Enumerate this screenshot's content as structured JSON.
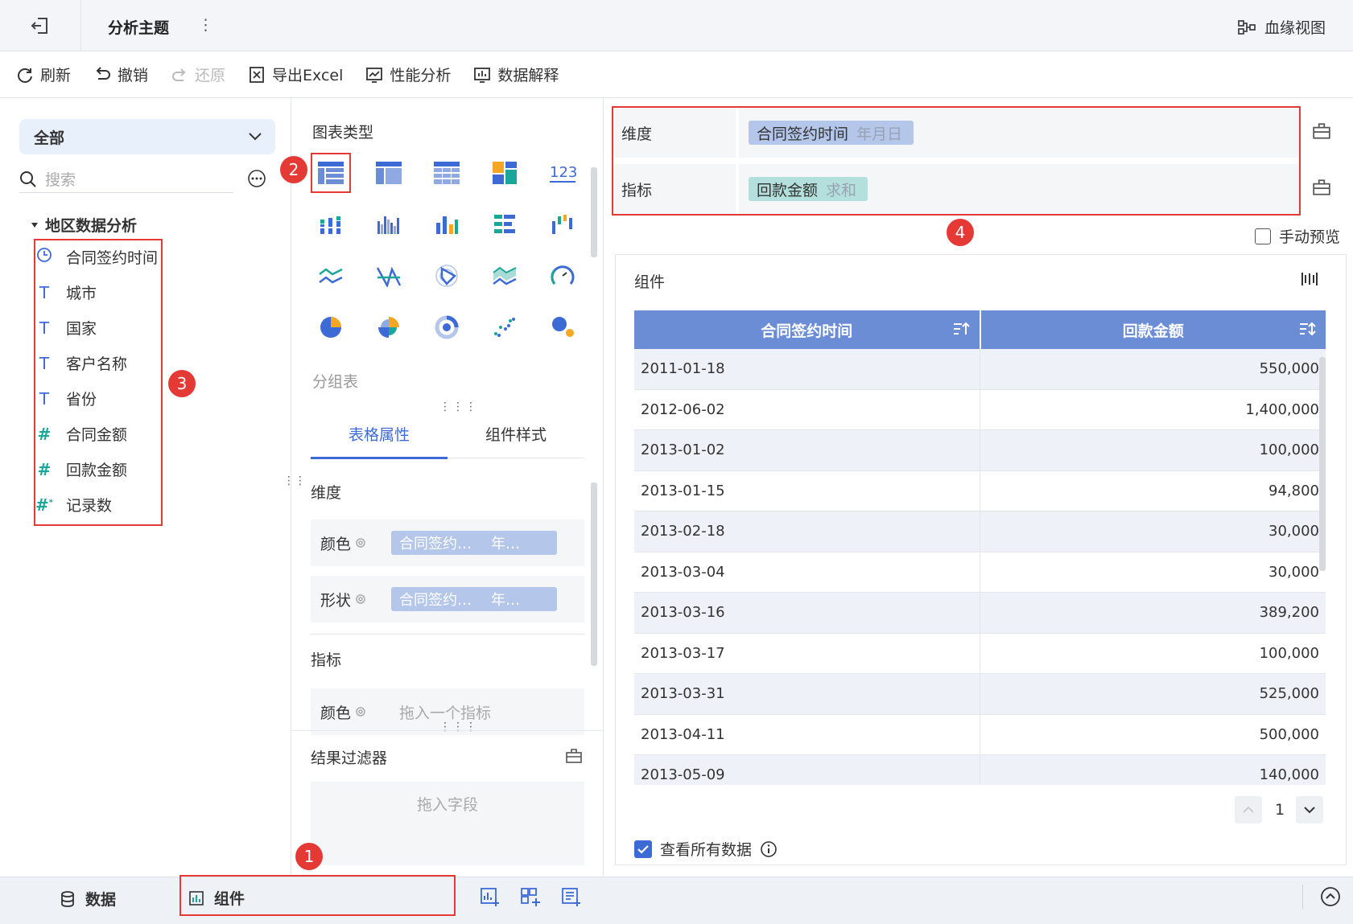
{
  "titlebar": {
    "title": "分析主题",
    "more": "⋮",
    "lineage_label": "血缘视图"
  },
  "toolbar": {
    "refresh": "刷新",
    "undo": "撤销",
    "redo": "还原",
    "export": "导出Excel",
    "perf": "性能分析",
    "explain": "数据解释"
  },
  "left": {
    "scope": "全部",
    "search_placeholder": "搜索",
    "group_title": "地区数据分析",
    "fields": [
      {
        "type": "time",
        "label": "合同签约时间"
      },
      {
        "type": "text",
        "label": "城市"
      },
      {
        "type": "text",
        "label": "国家"
      },
      {
        "type": "text",
        "label": "客户名称"
      },
      {
        "type": "text",
        "label": "省份"
      },
      {
        "type": "number",
        "label": "合同金额"
      },
      {
        "type": "number",
        "label": "回款金额"
      },
      {
        "type": "number-calc",
        "label": "记录数"
      }
    ]
  },
  "middle": {
    "chart_types_title": "图表类型",
    "selected_chart_name": "分组表",
    "tabs": [
      "表格属性",
      "组件样式"
    ],
    "dimension_title": "维度",
    "color_label": "颜色",
    "shape_label": "形状",
    "dim_chip_name": "合同签约…",
    "dim_chip_sub": "年…",
    "measure_title": "指标",
    "measure_color_placeholder": "拖入一个指标",
    "result_filter_title": "结果过滤器",
    "drop_field_placeholder": "拖入字段"
  },
  "right": {
    "dimension_label": "维度",
    "dimension_chip": {
      "name": "合同签约时间",
      "sub": "年月日"
    },
    "measure_label": "指标",
    "measure_chip": {
      "name": "回款金额",
      "sub": "求和"
    },
    "manual_preview": "手动预览",
    "widget_title": "组件",
    "table": {
      "columns": [
        "合同签约时间",
        "回款金额"
      ],
      "rows": [
        [
          "2011-01-18",
          "550,000"
        ],
        [
          "2012-06-02",
          "1,400,000"
        ],
        [
          "2013-01-02",
          "100,000"
        ],
        [
          "2013-01-15",
          "94,800"
        ],
        [
          "2013-02-18",
          "30,000"
        ],
        [
          "2013-03-04",
          "30,000"
        ],
        [
          "2013-03-16",
          "389,200"
        ],
        [
          "2013-03-17",
          "100,000"
        ],
        [
          "2013-03-31",
          "525,000"
        ],
        [
          "2013-04-11",
          "500,000"
        ],
        [
          "2013-05-09",
          "140,000"
        ]
      ]
    },
    "page": "1",
    "view_all": "查看所有数据"
  },
  "bottom": {
    "data_tab": "数据",
    "widget_tab": "组件"
  },
  "annotations": [
    "1",
    "2",
    "3",
    "4"
  ],
  "colors": {
    "accent": "#3d6bd6",
    "header": "#6b8dd6",
    "annotation": "#e53935",
    "number_field": "#1aa79a"
  }
}
